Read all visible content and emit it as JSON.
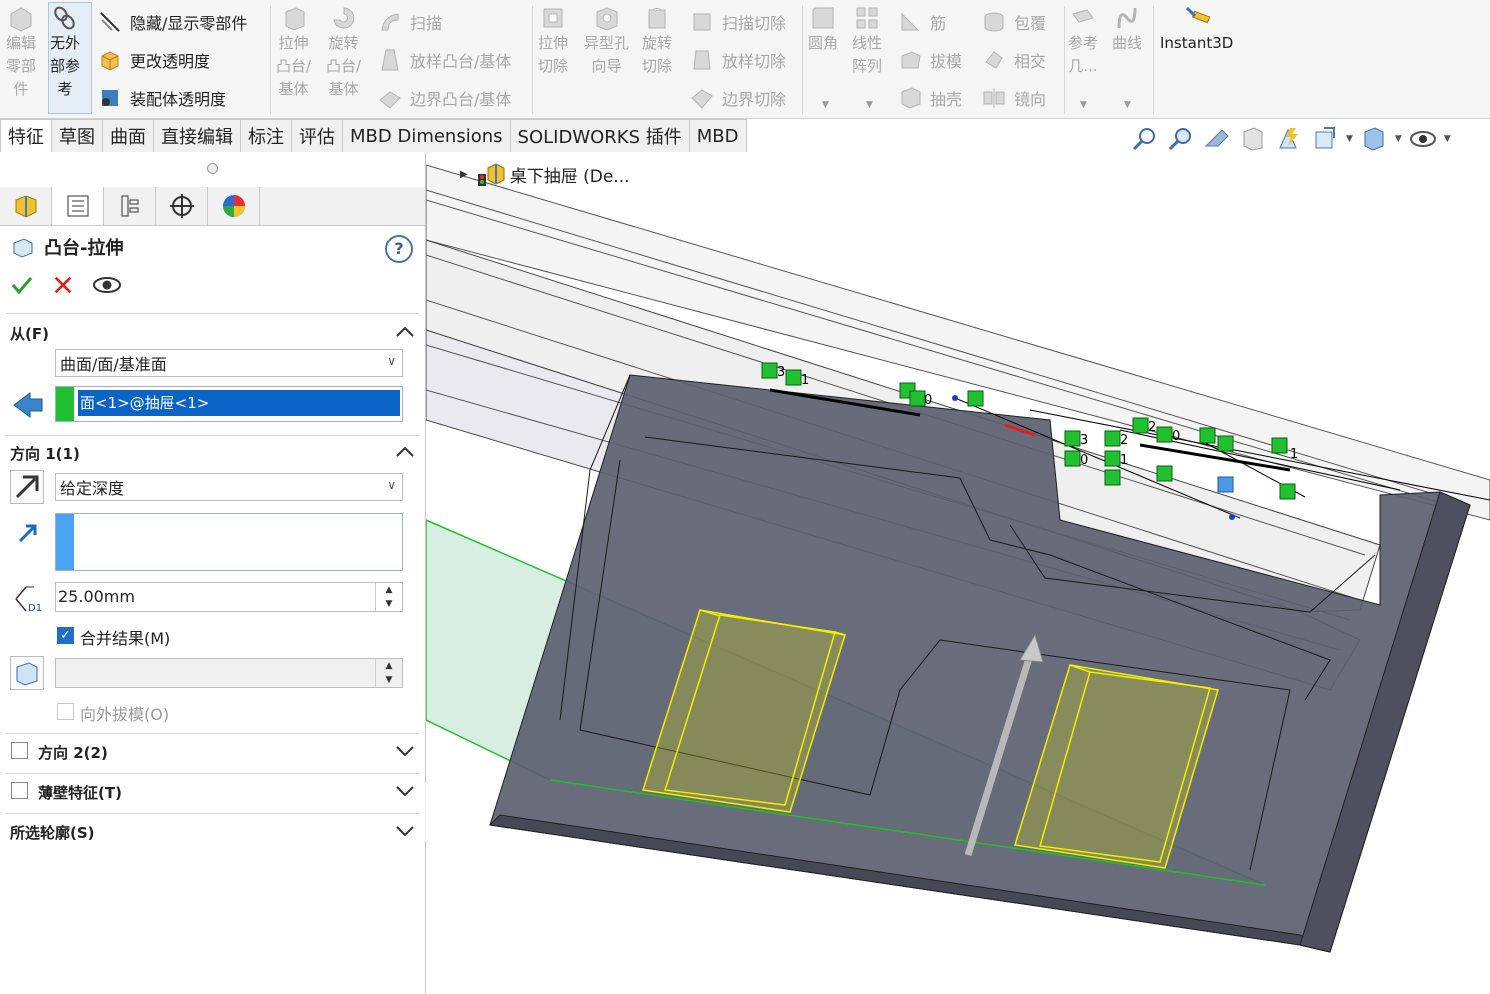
{
  "ribbon": {
    "edit_part": "编辑\n零部\n件",
    "no_external_refs": "无外\n部参\n考",
    "hide_show_parts": "隐藏/显示零部件",
    "change_transparency": "更改透明度",
    "assembly_transparency": "装配体透明度",
    "extrude_boss": "拉伸\n凸台/\n基体",
    "revolve_boss": "旋转\n凸台/\n基体",
    "sweep": "扫描",
    "loft_boss": "放样凸台/基体",
    "boundary_boss": "边界凸台/基体",
    "extrude_cut": "拉伸\n切除",
    "hole_wizard": "异型孔\n向导",
    "revolve_cut": "旋转\n切除",
    "sweep_cut": "扫描切除",
    "loft_cut": "放样切除",
    "boundary_cut": "边界切除",
    "fillet": "圆角",
    "linear_pattern": "线性\n阵列",
    "rib": "筋",
    "draft": "拔模",
    "shell": "抽壳",
    "wrap": "包覆",
    "intersect": "相交",
    "mirror": "镜向",
    "ref_geometry": "参考\n几...",
    "curves": "曲线",
    "instant3d": "Instant3D"
  },
  "tabs": [
    "特征",
    "草图",
    "曲面",
    "直接编辑",
    "标注",
    "评估",
    "MBD Dimensions",
    "SOLIDWORKS 插件",
    "MBD"
  ],
  "tree": {
    "label": "桌下抽屉 (De..."
  },
  "panel": {
    "title": "凸台-拉伸",
    "help": "?",
    "from_header": "从(F)",
    "from_option": "曲面/面/基准面",
    "from_selection": "面<1>@抽屉<1>",
    "dir1_header": "方向 1(1)",
    "end_condition": "给定深度",
    "depth": "25.00mm",
    "depth_icon_label": "D1",
    "merge_result": "合并结果(M)",
    "draft_outward": "向外拔模(O)",
    "dir2_header": "方向 2(2)",
    "thin_header": "薄壁特征(T)",
    "contours_header": "所选轮廓(S)"
  },
  "sketch_labels": [
    "3",
    "1",
    "0",
    "2",
    "3",
    "0",
    "2",
    "0",
    "1",
    "1"
  ],
  "colors": {
    "body": "#5c5f70",
    "highlight": "#2fbf3a",
    "preview": "#e6e600"
  }
}
